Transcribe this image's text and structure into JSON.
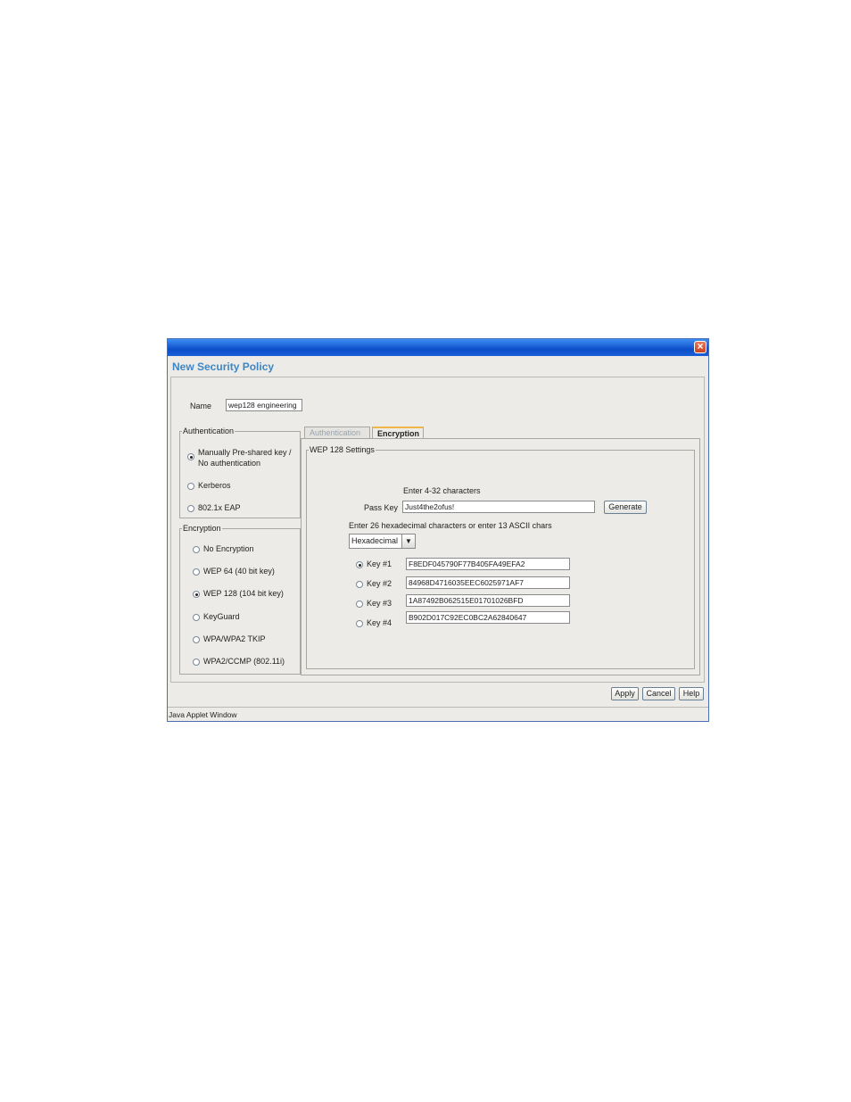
{
  "window": {
    "heading": "New Security Policy",
    "close_glyph": "×",
    "status_bar": "Java Applet Window"
  },
  "name": {
    "label": "Name",
    "value": "wep128 engineering"
  },
  "authentication": {
    "title": "Authentication",
    "options": [
      {
        "label_line1": "Manually Pre-shared key /",
        "label_line2": "No authentication",
        "selected": true
      },
      {
        "label": "Kerberos",
        "selected": false
      },
      {
        "label": "802.1x EAP",
        "selected": false
      }
    ]
  },
  "encryption": {
    "title": "Encryption",
    "options": [
      {
        "label": "No Encryption",
        "selected": false
      },
      {
        "label": "WEP 64 (40 bit key)",
        "selected": false
      },
      {
        "label": "WEP 128 (104 bit key)",
        "selected": true
      },
      {
        "label": "KeyGuard",
        "selected": false
      },
      {
        "label": "WPA/WPA2 TKIP",
        "selected": false
      },
      {
        "label": "WPA2/CCMP (802.11i)",
        "selected": false
      }
    ]
  },
  "tabs": [
    {
      "label": "Authentication",
      "active": false
    },
    {
      "label": "Encryption",
      "active": true
    }
  ],
  "wep": {
    "group_title": "WEP 128 Settings",
    "passkey_hint": "Enter 4-32 characters",
    "passkey_label": "Pass Key",
    "passkey_value": "Just4the2ofus!",
    "generate_label": "Generate",
    "key_hint": "Enter 26 hexadecimal characters or enter 13 ASCII chars",
    "format_selected": "Hexadecimal",
    "keys": [
      {
        "label": "Key #1",
        "value": "F8EDF045790F77B405FA49EFA2",
        "selected": true
      },
      {
        "label": "Key #2",
        "value": "84968D4716035EEC6025971AF7",
        "selected": false
      },
      {
        "label": "Key #3",
        "value": "1A87492B062515E01701026BFD",
        "selected": false
      },
      {
        "label": "Key #4",
        "value": "B902D017C92EC0BC2A62840647",
        "selected": false
      }
    ]
  },
  "buttons": {
    "apply": "Apply",
    "cancel": "Cancel",
    "help": "Help"
  }
}
